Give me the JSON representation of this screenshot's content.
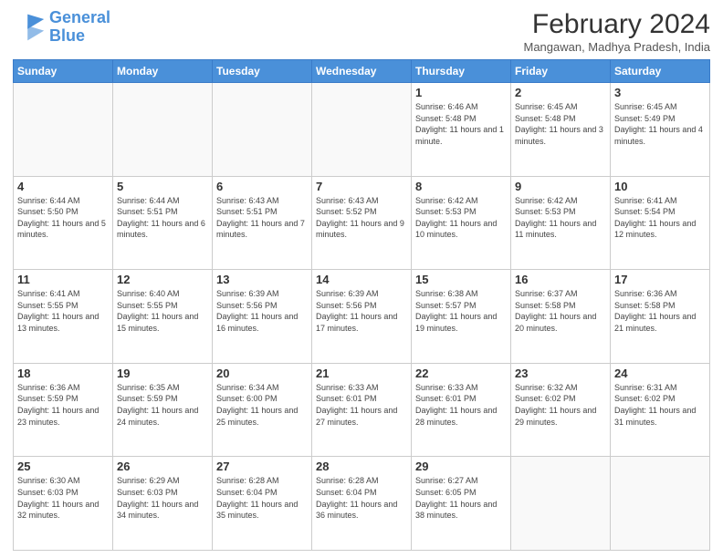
{
  "logo": {
    "line1": "General",
    "line2": "Blue"
  },
  "title": "February 2024",
  "location": "Mangawan, Madhya Pradesh, India",
  "days_of_week": [
    "Sunday",
    "Monday",
    "Tuesday",
    "Wednesday",
    "Thursday",
    "Friday",
    "Saturday"
  ],
  "weeks": [
    [
      {
        "day": "",
        "info": ""
      },
      {
        "day": "",
        "info": ""
      },
      {
        "day": "",
        "info": ""
      },
      {
        "day": "",
        "info": ""
      },
      {
        "day": "1",
        "info": "Sunrise: 6:46 AM\nSunset: 5:48 PM\nDaylight: 11 hours and 1 minute."
      },
      {
        "day": "2",
        "info": "Sunrise: 6:45 AM\nSunset: 5:48 PM\nDaylight: 11 hours and 3 minutes."
      },
      {
        "day": "3",
        "info": "Sunrise: 6:45 AM\nSunset: 5:49 PM\nDaylight: 11 hours and 4 minutes."
      }
    ],
    [
      {
        "day": "4",
        "info": "Sunrise: 6:44 AM\nSunset: 5:50 PM\nDaylight: 11 hours and 5 minutes."
      },
      {
        "day": "5",
        "info": "Sunrise: 6:44 AM\nSunset: 5:51 PM\nDaylight: 11 hours and 6 minutes."
      },
      {
        "day": "6",
        "info": "Sunrise: 6:43 AM\nSunset: 5:51 PM\nDaylight: 11 hours and 7 minutes."
      },
      {
        "day": "7",
        "info": "Sunrise: 6:43 AM\nSunset: 5:52 PM\nDaylight: 11 hours and 9 minutes."
      },
      {
        "day": "8",
        "info": "Sunrise: 6:42 AM\nSunset: 5:53 PM\nDaylight: 11 hours and 10 minutes."
      },
      {
        "day": "9",
        "info": "Sunrise: 6:42 AM\nSunset: 5:53 PM\nDaylight: 11 hours and 11 minutes."
      },
      {
        "day": "10",
        "info": "Sunrise: 6:41 AM\nSunset: 5:54 PM\nDaylight: 11 hours and 12 minutes."
      }
    ],
    [
      {
        "day": "11",
        "info": "Sunrise: 6:41 AM\nSunset: 5:55 PM\nDaylight: 11 hours and 13 minutes."
      },
      {
        "day": "12",
        "info": "Sunrise: 6:40 AM\nSunset: 5:55 PM\nDaylight: 11 hours and 15 minutes."
      },
      {
        "day": "13",
        "info": "Sunrise: 6:39 AM\nSunset: 5:56 PM\nDaylight: 11 hours and 16 minutes."
      },
      {
        "day": "14",
        "info": "Sunrise: 6:39 AM\nSunset: 5:56 PM\nDaylight: 11 hours and 17 minutes."
      },
      {
        "day": "15",
        "info": "Sunrise: 6:38 AM\nSunset: 5:57 PM\nDaylight: 11 hours and 19 minutes."
      },
      {
        "day": "16",
        "info": "Sunrise: 6:37 AM\nSunset: 5:58 PM\nDaylight: 11 hours and 20 minutes."
      },
      {
        "day": "17",
        "info": "Sunrise: 6:36 AM\nSunset: 5:58 PM\nDaylight: 11 hours and 21 minutes."
      }
    ],
    [
      {
        "day": "18",
        "info": "Sunrise: 6:36 AM\nSunset: 5:59 PM\nDaylight: 11 hours and 23 minutes."
      },
      {
        "day": "19",
        "info": "Sunrise: 6:35 AM\nSunset: 5:59 PM\nDaylight: 11 hours and 24 minutes."
      },
      {
        "day": "20",
        "info": "Sunrise: 6:34 AM\nSunset: 6:00 PM\nDaylight: 11 hours and 25 minutes."
      },
      {
        "day": "21",
        "info": "Sunrise: 6:33 AM\nSunset: 6:01 PM\nDaylight: 11 hours and 27 minutes."
      },
      {
        "day": "22",
        "info": "Sunrise: 6:33 AM\nSunset: 6:01 PM\nDaylight: 11 hours and 28 minutes."
      },
      {
        "day": "23",
        "info": "Sunrise: 6:32 AM\nSunset: 6:02 PM\nDaylight: 11 hours and 29 minutes."
      },
      {
        "day": "24",
        "info": "Sunrise: 6:31 AM\nSunset: 6:02 PM\nDaylight: 11 hours and 31 minutes."
      }
    ],
    [
      {
        "day": "25",
        "info": "Sunrise: 6:30 AM\nSunset: 6:03 PM\nDaylight: 11 hours and 32 minutes."
      },
      {
        "day": "26",
        "info": "Sunrise: 6:29 AM\nSunset: 6:03 PM\nDaylight: 11 hours and 34 minutes."
      },
      {
        "day": "27",
        "info": "Sunrise: 6:28 AM\nSunset: 6:04 PM\nDaylight: 11 hours and 35 minutes."
      },
      {
        "day": "28",
        "info": "Sunrise: 6:28 AM\nSunset: 6:04 PM\nDaylight: 11 hours and 36 minutes."
      },
      {
        "day": "29",
        "info": "Sunrise: 6:27 AM\nSunset: 6:05 PM\nDaylight: 11 hours and 38 minutes."
      },
      {
        "day": "",
        "info": ""
      },
      {
        "day": "",
        "info": ""
      }
    ]
  ]
}
